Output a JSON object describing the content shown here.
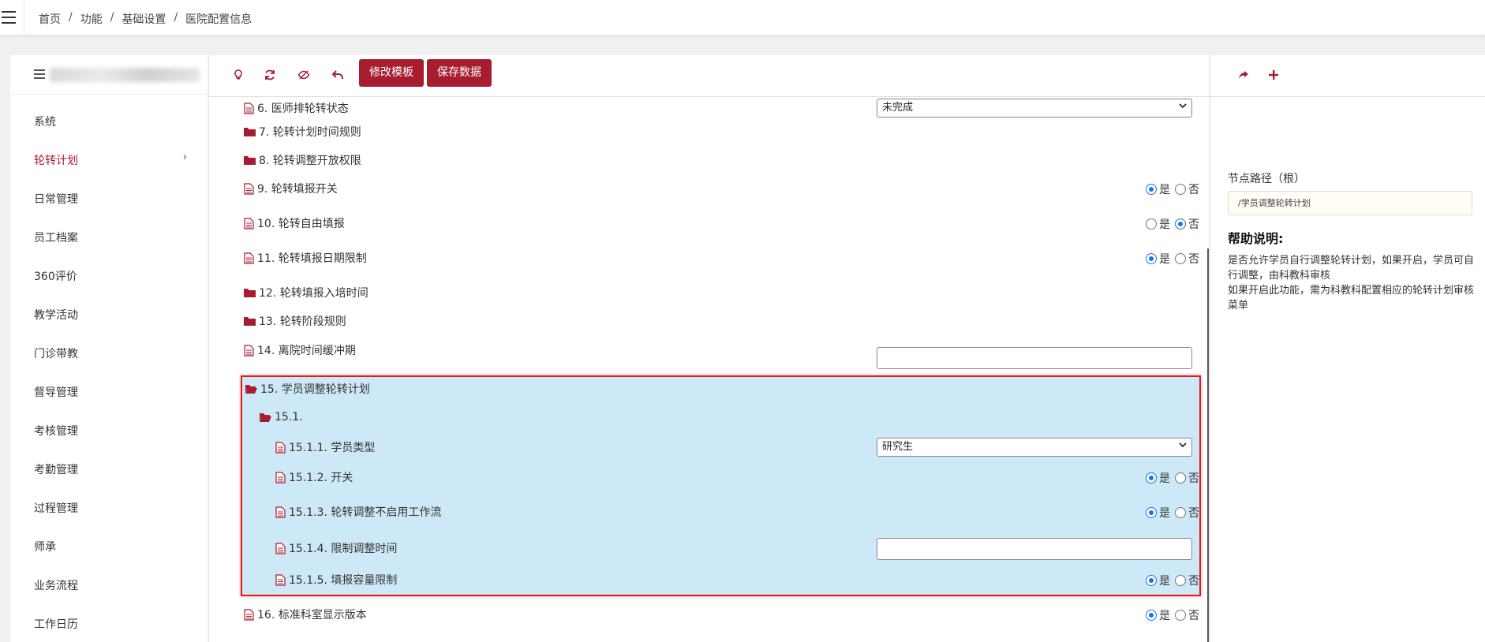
{
  "breadcrumb": [
    "首页",
    "功能",
    "基础设置",
    "医院配置信息"
  ],
  "sidebar": {
    "items": [
      {
        "label": "系统"
      },
      {
        "label": "轮转计划",
        "active": true
      },
      {
        "label": "日常管理"
      },
      {
        "label": "员工档案"
      },
      {
        "label": "360评价"
      },
      {
        "label": "教学活动"
      },
      {
        "label": "门诊带教"
      },
      {
        "label": "督导管理"
      },
      {
        "label": "考核管理"
      },
      {
        "label": "考勤管理"
      },
      {
        "label": "过程管理"
      },
      {
        "label": "师承"
      },
      {
        "label": "业务流程"
      },
      {
        "label": "工作日历"
      }
    ],
    "active_arrow": "›"
  },
  "toolbar": {
    "icons": [
      "lightbulb-icon",
      "refresh-icon",
      "eye-slash-icon",
      "undo-icon"
    ],
    "edit_template_label": "修改模板",
    "save_data_label": "保存数据"
  },
  "tree": {
    "r6": {
      "label": "6. 医师排轮转状态",
      "select_value": "未完成"
    },
    "r7": {
      "label": "7. 轮转计划时间规则"
    },
    "r8": {
      "label": "8. 轮转调整开放权限"
    },
    "r9": {
      "label": "9. 轮转填报开关",
      "yes": "是",
      "no": "否",
      "value": "yes"
    },
    "r10": {
      "label": "10. 轮转自由填报",
      "yes": "是",
      "no": "否",
      "value": "no"
    },
    "r11": {
      "label": "11. 轮转填报日期限制",
      "yes": "是",
      "no": "否",
      "value": "yes"
    },
    "r12": {
      "label": "12. 轮转填报入培时间"
    },
    "r13": {
      "label": "13. 轮转阶段规则"
    },
    "r14": {
      "label": "14. 离院时间缓冲期",
      "input_value": ""
    },
    "r15": {
      "label": "15. 学员调整轮转计划"
    },
    "r151": {
      "label": "15.1."
    },
    "r1511": {
      "label": "15.1.1. 学员类型",
      "select_value": "研究生"
    },
    "r1512": {
      "label": "15.1.2. 开关",
      "yes": "是",
      "no": "否",
      "value": "yes"
    },
    "r1513": {
      "label": "15.1.3. 轮转调整不启用工作流",
      "yes": "是",
      "no": "否",
      "value": "yes"
    },
    "r1514": {
      "label": "15.1.4. 限制调整时间",
      "input_value": ""
    },
    "r1515": {
      "label": "15.1.5. 填报容量限制",
      "yes": "是",
      "no": "否",
      "value": "yes"
    },
    "r16": {
      "label": "16. 标准科室显示版本",
      "yes": "是",
      "no": "否",
      "value": "yes"
    }
  },
  "right_panel": {
    "toolbar_icons": [
      "share-icon",
      "plus-icon"
    ],
    "node_path_label": "节点路径（根）",
    "node_path_value": "/学员调整轮转计划",
    "help_title": "帮助说明:",
    "help_line1": "是否允许学员自行调整轮转计划，如果开启，学员可自行调整，由科教科审核",
    "help_line2": "如果开启此功能，需为科教科配置相应的轮转计划审核菜单"
  },
  "colors": {
    "brand": "#a81c2f",
    "highlight_bg": "#cde8f7",
    "highlight_border": "#e01b1b",
    "radio_checked": "#1a73e8"
  }
}
